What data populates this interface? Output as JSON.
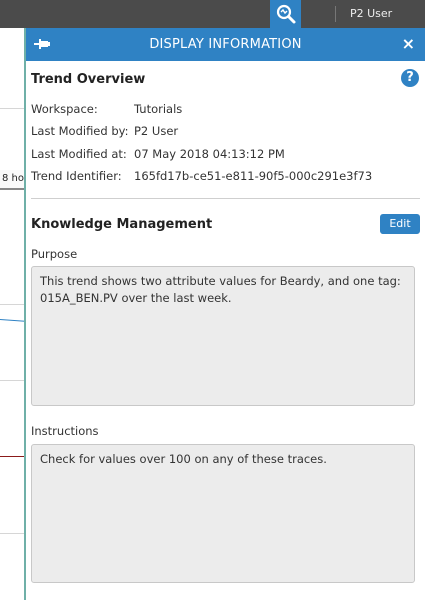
{
  "topbar": {
    "user_label": "P2 User"
  },
  "background": {
    "tab_label": "8 hou"
  },
  "panel": {
    "title": "DISPLAY INFORMATION",
    "close_glyph": "×",
    "trend_overview": {
      "title": "Trend Overview",
      "help_glyph": "?",
      "rows": [
        {
          "label": "Workspace:",
          "value": "Tutorials"
        },
        {
          "label": "Last Modified by:",
          "value": "P2 User"
        },
        {
          "label": "Last Modified at:",
          "value": "07 May 2018 04:13:12 PM"
        },
        {
          "label": "Trend Identifier:",
          "value": "165fd17b-ce51-e811-90f5-000c291e3f73"
        }
      ]
    },
    "knowledge": {
      "title": "Knowledge Management",
      "edit_label": "Edit",
      "purpose_label": "Purpose",
      "purpose_text": "This trend shows two attribute values for Beardy, and one tag: 015A_BEN.PV over the last week.",
      "instructions_label": "Instructions",
      "instructions_text": "Check for values over 100 on any of these traces."
    }
  },
  "icons": {
    "search": "search-icon",
    "pin": "pin-icon",
    "close": "close-icon",
    "help": "help-icon"
  },
  "colors": {
    "accent": "#2f82c4",
    "topbar": "#4b4b4b",
    "field_bg": "#ececec"
  }
}
